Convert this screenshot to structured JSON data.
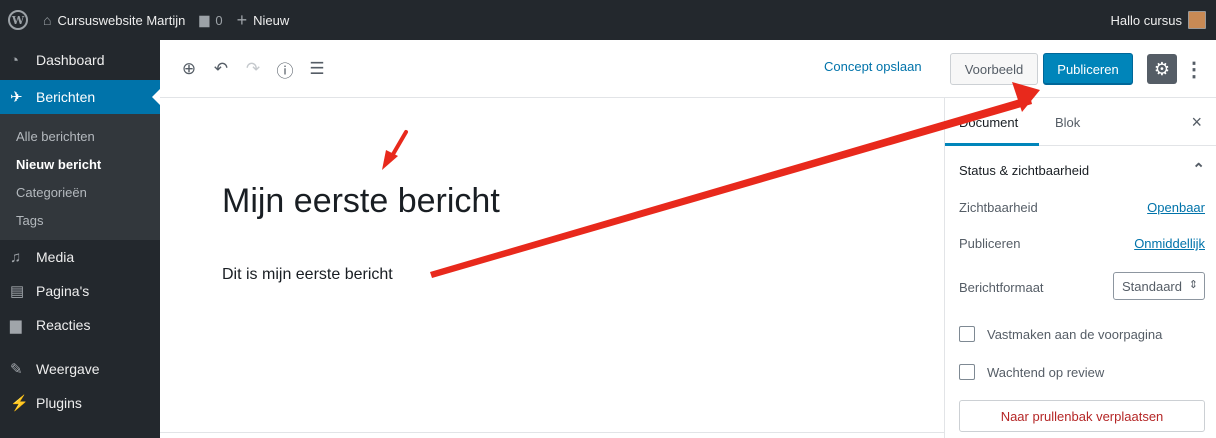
{
  "adminbar": {
    "site_name": "Cursuswebsite Martijn",
    "comments_count": "0",
    "new_label": "Nieuw",
    "greeting": "Hallo cursus"
  },
  "sidebar": {
    "dashboard": "Dashboard",
    "posts": "Berichten",
    "submenu": [
      "Alle berichten",
      "Nieuw bericht",
      "Categorieën",
      "Tags"
    ],
    "media": "Media",
    "pages": "Pagina's",
    "comments": "Reacties",
    "appearance": "Weergave",
    "plugins": "Plugins"
  },
  "toolbar": {
    "save_draft": "Concept opslaan",
    "preview": "Voorbeeld",
    "publish": "Publiceren"
  },
  "post": {
    "title": "Mijn eerste bericht",
    "body": "Dit is mijn eerste bericht"
  },
  "panel": {
    "tab_document": "Document",
    "tab_block": "Blok",
    "close": "×",
    "status_title": "Status & zichtbaarheid",
    "visibility_label": "Zichtbaarheid",
    "visibility_value": "Openbaar",
    "publish_label": "Publiceren",
    "publish_value": "Onmiddellijk",
    "format_label": "Berichtformaat",
    "format_value": "Standaard",
    "sticky_label": "Vastmaken aan de voorpagina",
    "pending_label": "Wachtend op review",
    "trash_label": "Naar prullenbak verplaatsen"
  },
  "colors": {
    "admin_dark": "#23282d",
    "accent_blue": "#0085ba",
    "arrow_red": "#e8291c"
  }
}
